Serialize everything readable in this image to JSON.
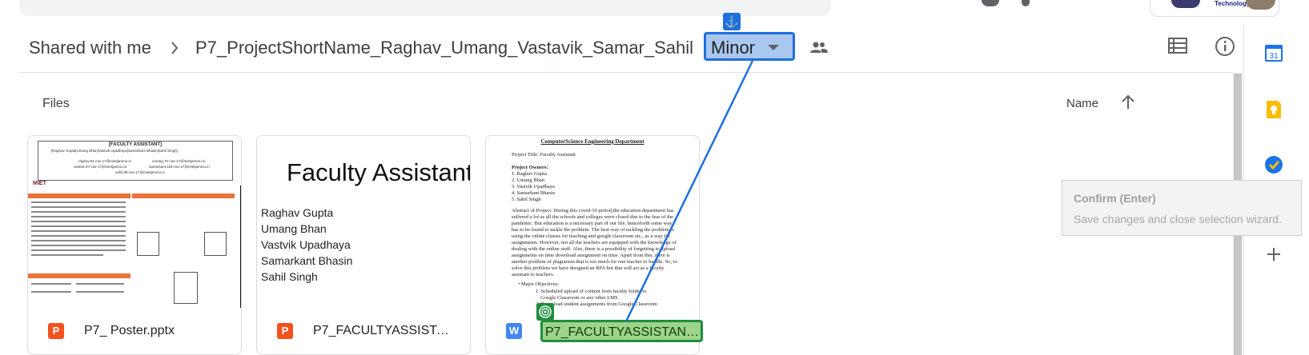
{
  "top_bar": {
    "org_text": "Technology"
  },
  "breadcrumb": {
    "items": [
      {
        "label": "Shared with me"
      },
      {
        "label": "P7_ProjectShortName_Raghav_Umang_Vastavik_Samar_Sahil"
      },
      {
        "label": "Minor"
      }
    ],
    "anchor_glyph": "⚓"
  },
  "files": {
    "section_title": "Files",
    "sort_label": "Name",
    "sort_direction": "ascending"
  },
  "cards": [
    {
      "type_letter": "P",
      "type_color": "#f4511e",
      "name": "P7_ Poster.pptx",
      "thumb": {
        "title": "[FACULTY ASSISTANT]",
        "members_line": "[Raghav Gupta|Umang Bhan|Vastvik Upadhaya|Samarkant Bhasin|Sahil Singh]",
        "emails": [
          "raghav.81-cse-17@mietjammu.in",
          "umang.75-cse-17@mietjammu.in",
          "vastvik.97-cse-17@mietjammu.in",
          "samarkant.118-cse-17@mietjammu.in",
          "sahil.86-cse-17@mietjammu.in"
        ],
        "logo_text": "MIET"
      }
    },
    {
      "type_letter": "P",
      "type_color": "#f4511e",
      "name": "P7_FACULTYASSISTAN…",
      "thumb": {
        "title": "Faculty Assistant",
        "names": [
          "Raghav Gupta",
          "Umang Bhan",
          "Vastvik Upadhaya",
          "Samarkant Bhasin",
          "Sahil Singh"
        ]
      }
    },
    {
      "type_letter": "W",
      "type_color": "#4285f4",
      "name": "P7_FACULTYASSISTAN…",
      "thumb": {
        "heading": "ComputerScience Engineering Department",
        "project_title": "Project Title: Faculty Assistant",
        "owners_label": "Project Owners:",
        "owners": [
          "1. Raghav Gupta",
          "2. Umang Bhan",
          "3. Vastvik Upadhaya",
          "4. Samarkant Bhasin",
          "5. Sahil Singh"
        ],
        "abstract_lines": [
          "Abstract of Project: During this covid-19 period,the education department has",
          "suffered a lot as all the schools and colleges were closed due to the fear of the",
          "pandemic. But education is a necessary part of our life, henceforth some way",
          "has to be found to tackle the problem. The best way of tackling the problem is",
          "using the online classes for teaching and google classroom etc., as a way for",
          "assignments. However, not all the teachers are equipped with the knowledge of",
          "dealing with the online stuff. Also, there is a possibility of forgetting to upload",
          "assignments on time download assignment on time. Apart from this, there is",
          "another problem of plagiarism that is too much for one teacher to handle. So, to",
          "solve this problem we have designed an RPA bot that will act as a faculty",
          "assistant to teachers."
        ],
        "objectives_label": "• Major Objectives:",
        "objectives": [
          "1. Scheduled upload of content from faculty folder to",
          "Google Classroom or any other LMS",
          "2. Download student assignments from Google Classroom",
          "or any other LMS",
          "3. Copies text from assignments and posts in plagiarism"
        ]
      }
    }
  ],
  "tooltip": {
    "title": "Confirm (Enter)",
    "body": "Save changes and close selection wizard."
  },
  "side_panel": {
    "calendar_day": "31"
  },
  "colors": {
    "selection_blue": "#1f6fde",
    "selection_green": "#1e8e3e"
  }
}
